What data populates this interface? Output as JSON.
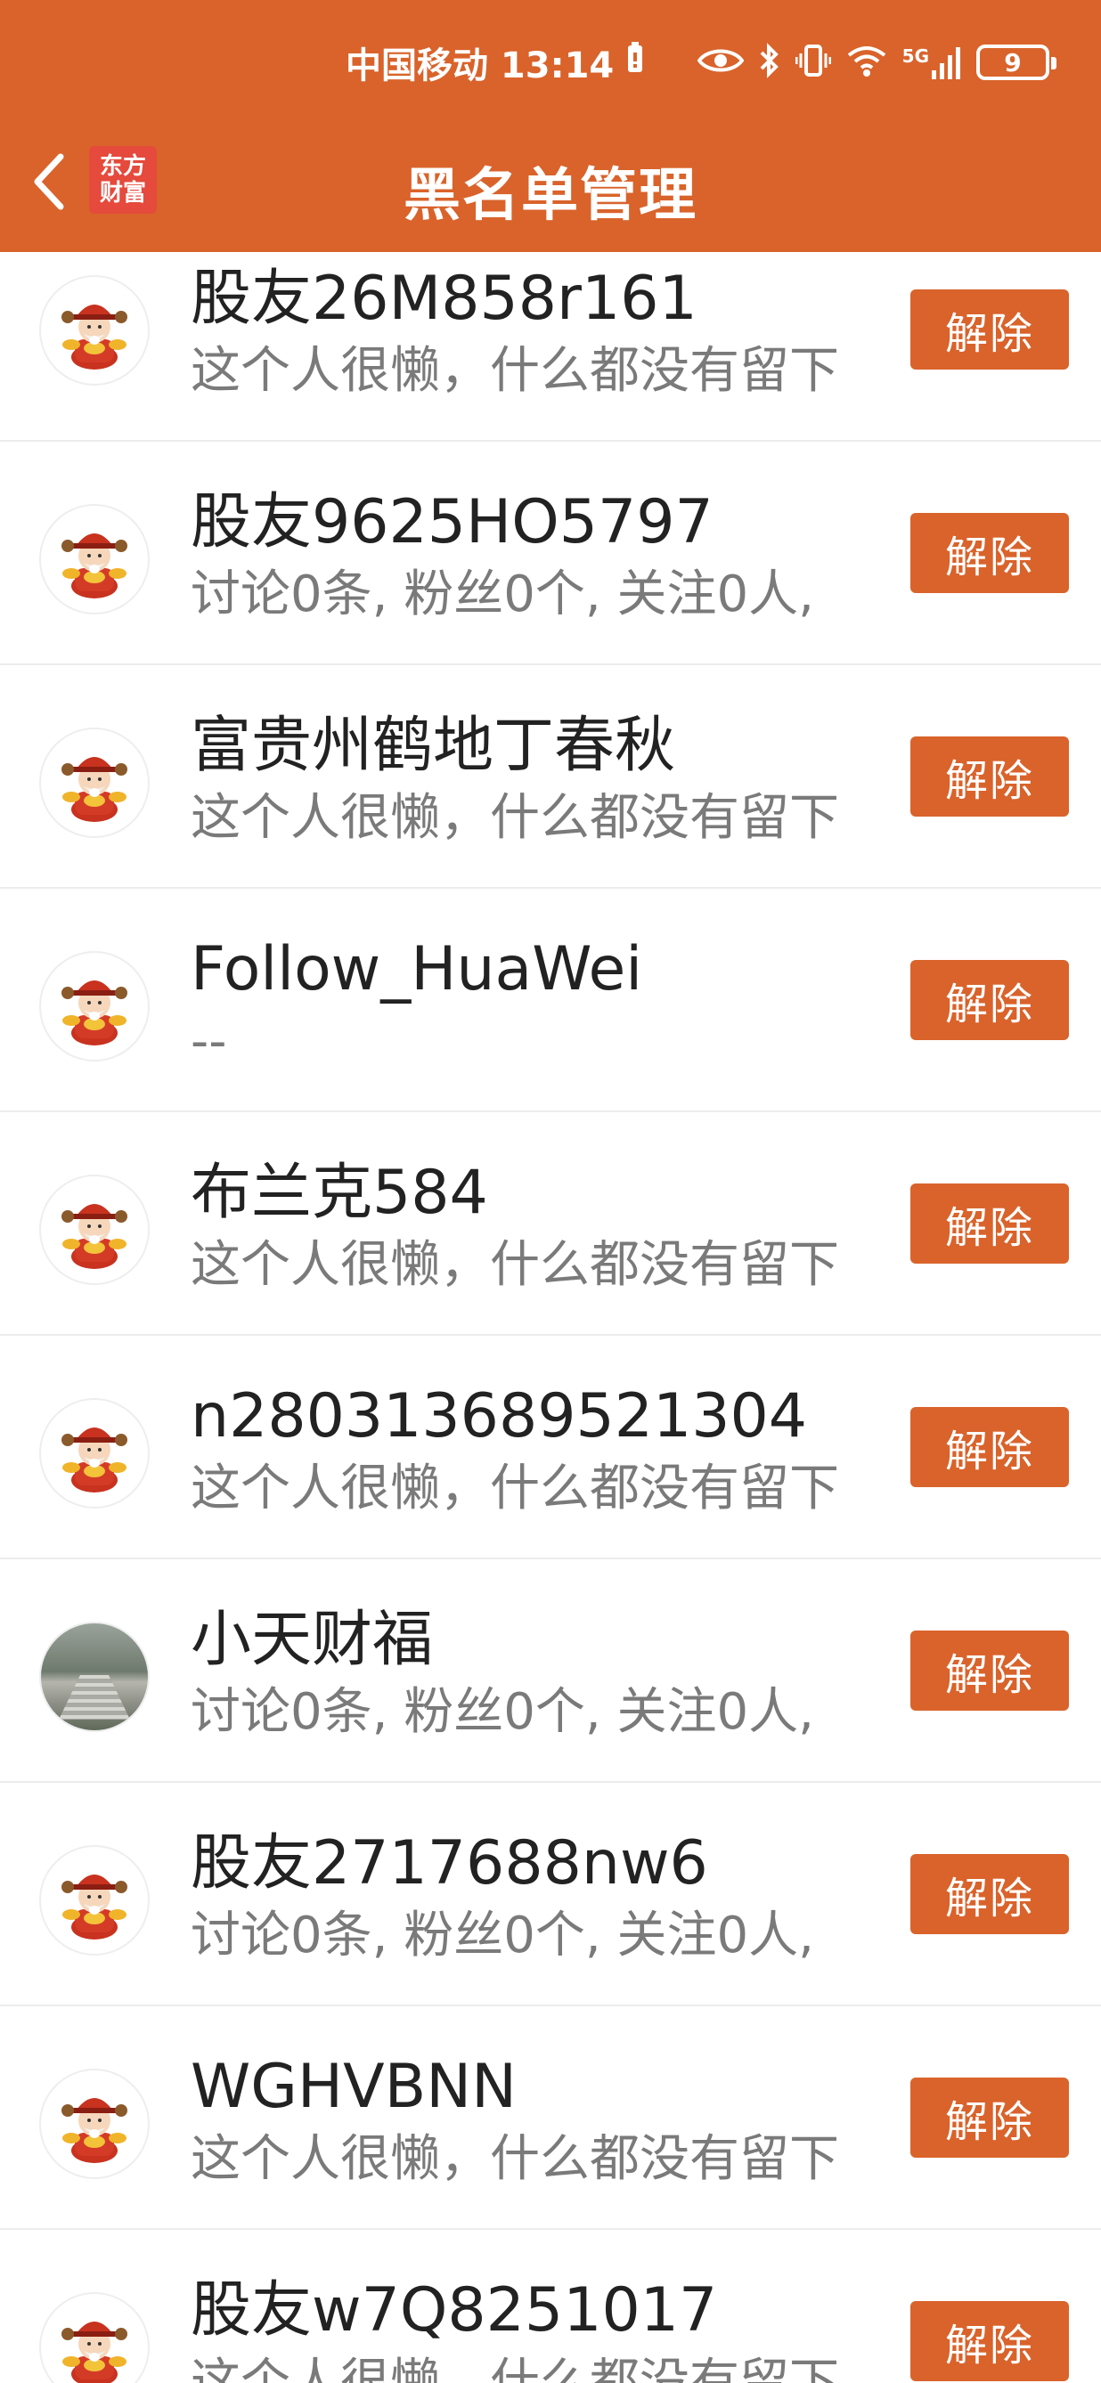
{
  "status_bar": {
    "carrier_time": "中国移动 13:14",
    "battery_level": "9",
    "network_label": "5G"
  },
  "header": {
    "title": "黑名单管理",
    "logo_text": "东方财富",
    "back_icon": "chevron-left-icon",
    "background_color": "#d9632b"
  },
  "unblock_label": "解除",
  "users": [
    {
      "name": "股友26M858r161",
      "desc": "这个人很懒，什么都没有留下",
      "avatar": "mascot"
    },
    {
      "name": "股友9625HO5797",
      "desc": "讨论0条, 粉丝0个, 关注0人,",
      "avatar": "mascot"
    },
    {
      "name": "富贵州鹤地丁春秋",
      "desc": "这个人很懒，什么都没有留下",
      "avatar": "mascot"
    },
    {
      "name": "Follow_HuaWei",
      "desc": "--",
      "avatar": "mascot"
    },
    {
      "name": "布兰克584",
      "desc": "这个人很懒，什么都没有留下",
      "avatar": "mascot"
    },
    {
      "name": "n280313689521304",
      "desc": "这个人很懒，什么都没有留下",
      "avatar": "mascot"
    },
    {
      "name": "小天财福",
      "desc": "讨论0条, 粉丝0个, 关注0人,",
      "avatar": "photo"
    },
    {
      "name": "股友2717688nw6",
      "desc": "讨论0条, 粉丝0个, 关注0人,",
      "avatar": "mascot"
    },
    {
      "name": "WGHVBNN",
      "desc": "这个人很懒，什么都没有留下",
      "avatar": "mascot"
    },
    {
      "name": "股友w7Q8251017",
      "desc": "这个人很懒，什么都没有留下",
      "avatar": "mascot"
    }
  ]
}
